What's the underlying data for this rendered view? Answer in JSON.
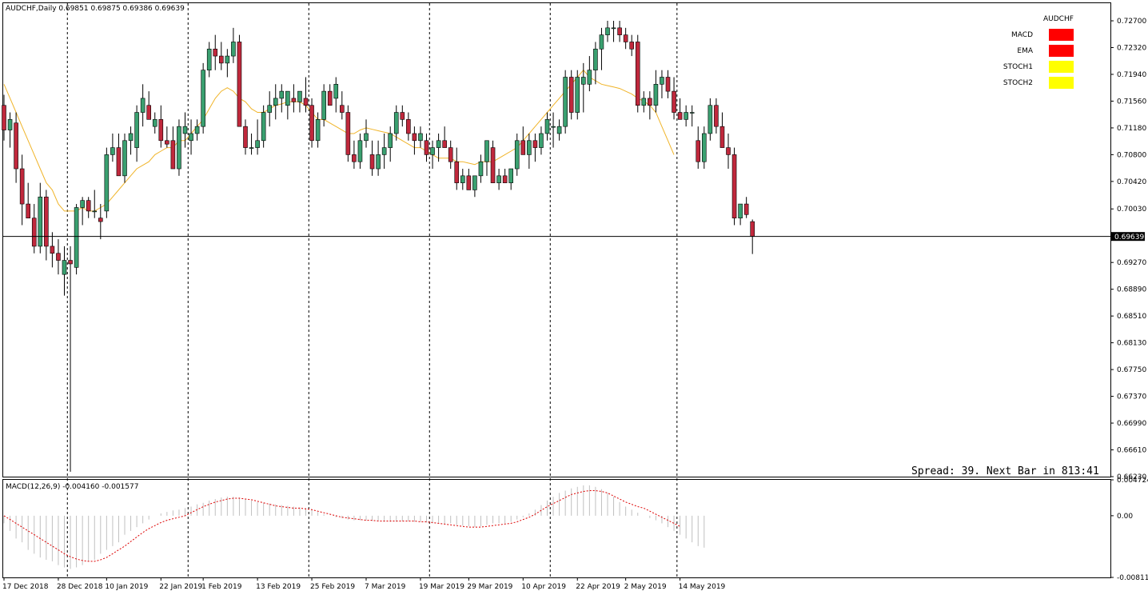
{
  "symbol_header": "AUDCHF,Daily  0.69851 0.69875 0.69386 0.69639",
  "current_price": "0.69639",
  "spread_text": "Spread: 39. Next Bar in 813:41",
  "indicator_panel": {
    "title": "AUDCHF",
    "rows": [
      {
        "label": "MACD",
        "color": "#ff0000"
      },
      {
        "label": "EMA",
        "color": "#ff0000"
      },
      {
        "label": "STOCH1",
        "color": "#ffff00"
      },
      {
        "label": "STOCH2",
        "color": "#ffff00"
      }
    ]
  },
  "macd_header": "MACD(12,26,9) -0.004160 -0.001577",
  "colors": {
    "bull": "#3aa070",
    "bear": "#c0283c",
    "ema": "#f0b429",
    "signal": "#dd0000",
    "hist": "#c0c0c0"
  },
  "chart_data": [
    {
      "type": "candlestick",
      "price_axis_labels": [
        "0.72700",
        "0.72320",
        "0.71940",
        "0.71560",
        "0.71180",
        "0.70800",
        "0.70420",
        "0.70030",
        "0.69270",
        "0.68890",
        "0.68510",
        "0.68130",
        "0.67750",
        "0.67370",
        "0.66990",
        "0.66610",
        "0.66230"
      ],
      "ylim": [
        0.6623,
        0.7295
      ],
      "x_labels": [
        "17 Dec 2018",
        "28 Dec 2018",
        "10 Jan 2019",
        "22 Jan 2019",
        "1 Feb 2019",
        "13 Feb 2019",
        "25 Feb 2019",
        "7 Mar 2019",
        "19 Mar 2019",
        "29 Mar 2019",
        "10 Apr 2019",
        "22 Apr 2019",
        "2 May 2019",
        "14 May 2019"
      ],
      "x_label_index": [
        0,
        9,
        17,
        26,
        33,
        42,
        51,
        60,
        69,
        77,
        86,
        95,
        103,
        112
      ],
      "separator_index": [
        10.5,
        30.5,
        50.5,
        70.5,
        90.5,
        111.5
      ],
      "ohlc": [
        [
          0.715,
          0.7165,
          0.71,
          0.7115
        ],
        [
          0.7115,
          0.714,
          0.709,
          0.713
        ],
        [
          0.7125,
          0.714,
          0.704,
          0.706
        ],
        [
          0.706,
          0.708,
          0.698,
          0.701
        ],
        [
          0.701,
          0.704,
          0.699,
          0.699
        ],
        [
          0.699,
          0.701,
          0.694,
          0.695
        ],
        [
          0.695,
          0.704,
          0.694,
          0.702
        ],
        [
          0.702,
          0.703,
          0.693,
          0.695
        ],
        [
          0.695,
          0.697,
          0.692,
          0.694
        ],
        [
          0.694,
          0.696,
          0.691,
          0.693
        ],
        [
          0.691,
          0.695,
          0.688,
          0.693
        ],
        [
          0.693,
          0.695,
          0.663,
          0.6925
        ],
        [
          0.692,
          0.701,
          0.691,
          0.7005
        ],
        [
          0.7005,
          0.702,
          0.698,
          0.7015
        ],
        [
          0.7015,
          0.702,
          0.699,
          0.7
        ],
        [
          0.7,
          0.703,
          0.699,
          0.7
        ],
        [
          0.699,
          0.701,
          0.696,
          0.6985
        ],
        [
          0.7,
          0.709,
          0.699,
          0.708
        ],
        [
          0.708,
          0.711,
          0.707,
          0.709
        ],
        [
          0.709,
          0.711,
          0.705,
          0.705
        ],
        [
          0.705,
          0.711,
          0.704,
          0.71
        ],
        [
          0.71,
          0.712,
          0.708,
          0.711
        ],
        [
          0.709,
          0.715,
          0.707,
          0.714
        ],
        [
          0.714,
          0.718,
          0.712,
          0.716
        ],
        [
          0.715,
          0.717,
          0.713,
          0.713
        ],
        [
          0.712,
          0.714,
          0.711,
          0.713
        ],
        [
          0.713,
          0.715,
          0.709,
          0.71
        ],
        [
          0.71,
          0.712,
          0.709,
          0.7095
        ],
        [
          0.71,
          0.712,
          0.706,
          0.706
        ],
        [
          0.706,
          0.713,
          0.705,
          0.712
        ],
        [
          0.711,
          0.714,
          0.709,
          0.712
        ],
        [
          0.71,
          0.713,
          0.708,
          0.711
        ],
        [
          0.711,
          0.713,
          0.71,
          0.712
        ],
        [
          0.712,
          0.721,
          0.711,
          0.72
        ],
        [
          0.72,
          0.724,
          0.719,
          0.723
        ],
        [
          0.723,
          0.725,
          0.72,
          0.722
        ],
        [
          0.722,
          0.724,
          0.72,
          0.721
        ],
        [
          0.721,
          0.723,
          0.719,
          0.722
        ],
        [
          0.722,
          0.726,
          0.721,
          0.724
        ],
        [
          0.724,
          0.725,
          0.712,
          0.712
        ],
        [
          0.712,
          0.713,
          0.708,
          0.709
        ],
        [
          0.709,
          0.711,
          0.708,
          0.709
        ],
        [
          0.709,
          0.713,
          0.708,
          0.71
        ],
        [
          0.71,
          0.715,
          0.709,
          0.714
        ],
        [
          0.714,
          0.717,
          0.712,
          0.715
        ],
        [
          0.715,
          0.718,
          0.713,
          0.716
        ],
        [
          0.716,
          0.718,
          0.714,
          0.717
        ],
        [
          0.715,
          0.717,
          0.713,
          0.717
        ],
        [
          0.716,
          0.718,
          0.714,
          0.7155
        ],
        [
          0.7155,
          0.717,
          0.714,
          0.717
        ],
        [
          0.716,
          0.719,
          0.714,
          0.715
        ],
        [
          0.715,
          0.716,
          0.709,
          0.71
        ],
        [
          0.71,
          0.714,
          0.709,
          0.713
        ],
        [
          0.713,
          0.718,
          0.712,
          0.717
        ],
        [
          0.717,
          0.718,
          0.715,
          0.715
        ],
        [
          0.716,
          0.719,
          0.714,
          0.718
        ],
        [
          0.715,
          0.717,
          0.713,
          0.714
        ],
        [
          0.714,
          0.715,
          0.707,
          0.708
        ],
        [
          0.708,
          0.71,
          0.706,
          0.707
        ],
        [
          0.707,
          0.711,
          0.706,
          0.71
        ],
        [
          0.71,
          0.713,
          0.709,
          0.711
        ],
        [
          0.708,
          0.71,
          0.705,
          0.706
        ],
        [
          0.706,
          0.71,
          0.705,
          0.708
        ],
        [
          0.708,
          0.711,
          0.706,
          0.709
        ],
        [
          0.709,
          0.712,
          0.707,
          0.711
        ],
        [
          0.711,
          0.715,
          0.71,
          0.714
        ],
        [
          0.714,
          0.715,
          0.712,
          0.713
        ],
        [
          0.713,
          0.714,
          0.71,
          0.711
        ],
        [
          0.711,
          0.712,
          0.708,
          0.71
        ],
        [
          0.71,
          0.712,
          0.709,
          0.711
        ],
        [
          0.71,
          0.711,
          0.707,
          0.708
        ],
        [
          0.708,
          0.71,
          0.706,
          0.709
        ],
        [
          0.709,
          0.711,
          0.707,
          0.71
        ],
        [
          0.71,
          0.712,
          0.709,
          0.709
        ],
        [
          0.709,
          0.71,
          0.706,
          0.707
        ],
        [
          0.707,
          0.709,
          0.703,
          0.704
        ],
        [
          0.704,
          0.706,
          0.703,
          0.705
        ],
        [
          0.705,
          0.706,
          0.703,
          0.703
        ],
        [
          0.703,
          0.705,
          0.702,
          0.705
        ],
        [
          0.705,
          0.708,
          0.704,
          0.707
        ],
        [
          0.707,
          0.71,
          0.705,
          0.71
        ],
        [
          0.709,
          0.71,
          0.704,
          0.704
        ],
        [
          0.704,
          0.706,
          0.703,
          0.705
        ],
        [
          0.705,
          0.706,
          0.704,
          0.704
        ],
        [
          0.704,
          0.706,
          0.703,
          0.706
        ],
        [
          0.706,
          0.711,
          0.705,
          0.71
        ],
        [
          0.71,
          0.712,
          0.708,
          0.708
        ],
        [
          0.708,
          0.711,
          0.706,
          0.71
        ],
        [
          0.71,
          0.711,
          0.707,
          0.709
        ],
        [
          0.709,
          0.712,
          0.708,
          0.711
        ],
        [
          0.711,
          0.714,
          0.71,
          0.713
        ],
        [
          0.712,
          0.714,
          0.709,
          0.712
        ],
        [
          0.711,
          0.713,
          0.71,
          0.712
        ],
        [
          0.712,
          0.72,
          0.711,
          0.719
        ],
        [
          0.719,
          0.72,
          0.713,
          0.714
        ],
        [
          0.714,
          0.72,
          0.713,
          0.719
        ],
        [
          0.718,
          0.721,
          0.714,
          0.719
        ],
        [
          0.718,
          0.722,
          0.717,
          0.72
        ],
        [
          0.72,
          0.724,
          0.718,
          0.723
        ],
        [
          0.723,
          0.726,
          0.72,
          0.725
        ],
        [
          0.725,
          0.727,
          0.724,
          0.726
        ],
        [
          0.726,
          0.727,
          0.724,
          0.726
        ],
        [
          0.726,
          0.727,
          0.724,
          0.725
        ],
        [
          0.725,
          0.726,
          0.723,
          0.724
        ],
        [
          0.724,
          0.725,
          0.722,
          0.723
        ],
        [
          0.724,
          0.725,
          0.714,
          0.715
        ],
        [
          0.715,
          0.717,
          0.714,
          0.716
        ],
        [
          0.716,
          0.717,
          0.713,
          0.715
        ],
        [
          0.715,
          0.72,
          0.714,
          0.718
        ],
        [
          0.718,
          0.72,
          0.716,
          0.719
        ],
        [
          0.719,
          0.72,
          0.716,
          0.717
        ],
        [
          0.717,
          0.719,
          0.713,
          0.714
        ],
        [
          0.714,
          0.716,
          0.713,
          0.713
        ],
        [
          0.713,
          0.715,
          0.712,
          0.714
        ],
        [
          0.714,
          0.715,
          0.712,
          0.714
        ],
        [
          0.71,
          0.712,
          0.706,
          0.707
        ],
        [
          0.707,
          0.712,
          0.706,
          0.711
        ],
        [
          0.711,
          0.716,
          0.71,
          0.715
        ],
        [
          0.715,
          0.716,
          0.711,
          0.712
        ],
        [
          0.712,
          0.714,
          0.709,
          0.709
        ],
        [
          0.709,
          0.711,
          0.706,
          0.708
        ],
        [
          0.708,
          0.709,
          0.698,
          0.699
        ],
        [
          0.699,
          0.701,
          0.698,
          0.701
        ],
        [
          0.701,
          0.702,
          0.699,
          0.6995
        ],
        [
          0.6985,
          0.6988,
          0.6939,
          0.6964
        ]
      ],
      "ema": [
        0.718,
        0.716,
        0.714,
        0.712,
        0.71,
        0.708,
        0.706,
        0.704,
        0.703,
        0.701,
        0.7,
        0.7,
        0.7,
        0.7005,
        0.7,
        0.7,
        0.7005,
        0.701,
        0.702,
        0.703,
        0.704,
        0.705,
        0.706,
        0.7065,
        0.707,
        0.708,
        0.7085,
        0.709,
        0.709,
        0.71,
        0.71,
        0.711,
        0.712,
        0.713,
        0.7145,
        0.716,
        0.717,
        0.7175,
        0.717,
        0.716,
        0.7155,
        0.7145,
        0.714,
        0.714,
        0.7145,
        0.715,
        0.7152,
        0.7155,
        0.7155,
        0.7155,
        0.715,
        0.714,
        0.713,
        0.713,
        0.7125,
        0.712,
        0.7115,
        0.711,
        0.711,
        0.7115,
        0.7118,
        0.7116,
        0.7114,
        0.7112,
        0.711,
        0.7105,
        0.71,
        0.7095,
        0.709,
        0.709,
        0.7085,
        0.708,
        0.7075,
        0.7075,
        0.7075,
        0.707,
        0.707,
        0.7068,
        0.7066,
        0.707,
        0.707,
        0.707,
        0.7075,
        0.708,
        0.7085,
        0.709,
        0.71,
        0.711,
        0.712,
        0.713,
        0.714,
        0.715,
        0.716,
        0.717,
        0.718,
        0.719,
        0.72,
        0.719,
        0.7185,
        0.718,
        0.7178,
        0.7176,
        0.7174,
        0.717,
        0.7166,
        0.716,
        0.7156,
        0.715,
        0.714,
        0.712,
        0.71,
        0.708
      ],
      "macd_axis_labels": [
        "0.004724",
        "0.00",
        "-0.008118"
      ],
      "macd_ylim": [
        -0.008118,
        0.004724
      ],
      "macd_hist": [
        -0.001,
        -0.002,
        -0.003,
        -0.0035,
        -0.0045,
        -0.005,
        -0.0055,
        -0.0058,
        -0.006,
        -0.0065,
        -0.0068,
        -0.007,
        -0.0068,
        -0.0065,
        -0.006,
        -0.0058,
        -0.005,
        -0.0045,
        -0.004,
        -0.0035,
        -0.0025,
        -0.002,
        -0.0015,
        -0.001,
        -0.0005,
        0.0,
        0.0003,
        0.0005,
        0.0007,
        0.0008,
        0.001,
        0.0012,
        0.0015,
        0.0017,
        0.002,
        0.0022,
        0.0024,
        0.0025,
        0.0025,
        0.0024,
        0.0022,
        0.002,
        0.0018,
        0.0017,
        0.0016,
        0.0015,
        0.0014,
        0.0013,
        0.0012,
        0.0011,
        0.001,
        0.0008,
        0.0005,
        0.0002,
        0.0,
        -0.0002,
        -0.0003,
        -0.0005,
        -0.0006,
        -0.0006,
        -0.0006,
        -0.0007,
        -0.0007,
        -0.0008,
        -0.0008,
        -0.0008,
        -0.0007,
        -0.0007,
        -0.0008,
        -0.0008,
        -0.0009,
        -0.001,
        -0.001,
        -0.0011,
        -0.001,
        -0.0012,
        -0.0013,
        -0.0014,
        -0.0015,
        -0.0014,
        -0.0012,
        -0.001,
        -0.001,
        -0.001,
        -0.0008,
        -0.0005,
        -0.0002,
        0.0003,
        0.0008,
        0.0014,
        0.002,
        0.0025,
        0.003,
        0.0033,
        0.0036,
        0.0038,
        0.004,
        0.004,
        0.0038,
        0.0035,
        0.003,
        0.0025,
        0.0018,
        0.0012,
        0.0008,
        0.0004,
        0.0,
        -0.0003,
        -0.0006,
        -0.001,
        -0.0015,
        -0.002,
        -0.0025,
        -0.003,
        -0.0035,
        -0.004,
        -0.0042
      ],
      "macd_signal": [
        0.0,
        -0.0005,
        -0.001,
        -0.0015,
        -0.002,
        -0.0025,
        -0.003,
        -0.0035,
        -0.004,
        -0.0045,
        -0.005,
        -0.0054,
        -0.0057,
        -0.0059,
        -0.006,
        -0.006,
        -0.0058,
        -0.0055,
        -0.005,
        -0.0045,
        -0.004,
        -0.0034,
        -0.0028,
        -0.0022,
        -0.0017,
        -0.0013,
        -0.0009,
        -0.0006,
        -0.0004,
        -0.0002,
        0.0,
        0.0004,
        0.0008,
        0.0012,
        0.0015,
        0.0018,
        0.002,
        0.0022,
        0.0023,
        0.0023,
        0.0022,
        0.0021,
        0.0019,
        0.0017,
        0.0015,
        0.0013,
        0.0012,
        0.0011,
        0.001,
        0.001,
        0.0009,
        0.0008,
        0.0006,
        0.0004,
        0.0002,
        0.0,
        -0.0002,
        -0.0003,
        -0.0004,
        -0.0005,
        -0.0006,
        -0.0006,
        -0.0007,
        -0.0007,
        -0.0007,
        -0.0007,
        -0.0007,
        -0.0007,
        -0.0007,
        -0.0008,
        -0.0008,
        -0.0009,
        -0.001,
        -0.0011,
        -0.0012,
        -0.0013,
        -0.0014,
        -0.0015,
        -0.0015,
        -0.0015,
        -0.0014,
        -0.0013,
        -0.0012,
        -0.0011,
        -0.001,
        -0.0008,
        -0.0005,
        -0.0002,
        0.0002,
        0.0007,
        0.0012,
        0.0016,
        0.002,
        0.0024,
        0.0028,
        0.003,
        0.0032,
        0.0033,
        0.0033,
        0.0032,
        0.003,
        0.0026,
        0.0022,
        0.0018,
        0.0015,
        0.0012,
        0.001,
        0.0006,
        0.0002,
        -0.0002,
        -0.0006,
        -0.001,
        -0.0014
      ]
    }
  ]
}
